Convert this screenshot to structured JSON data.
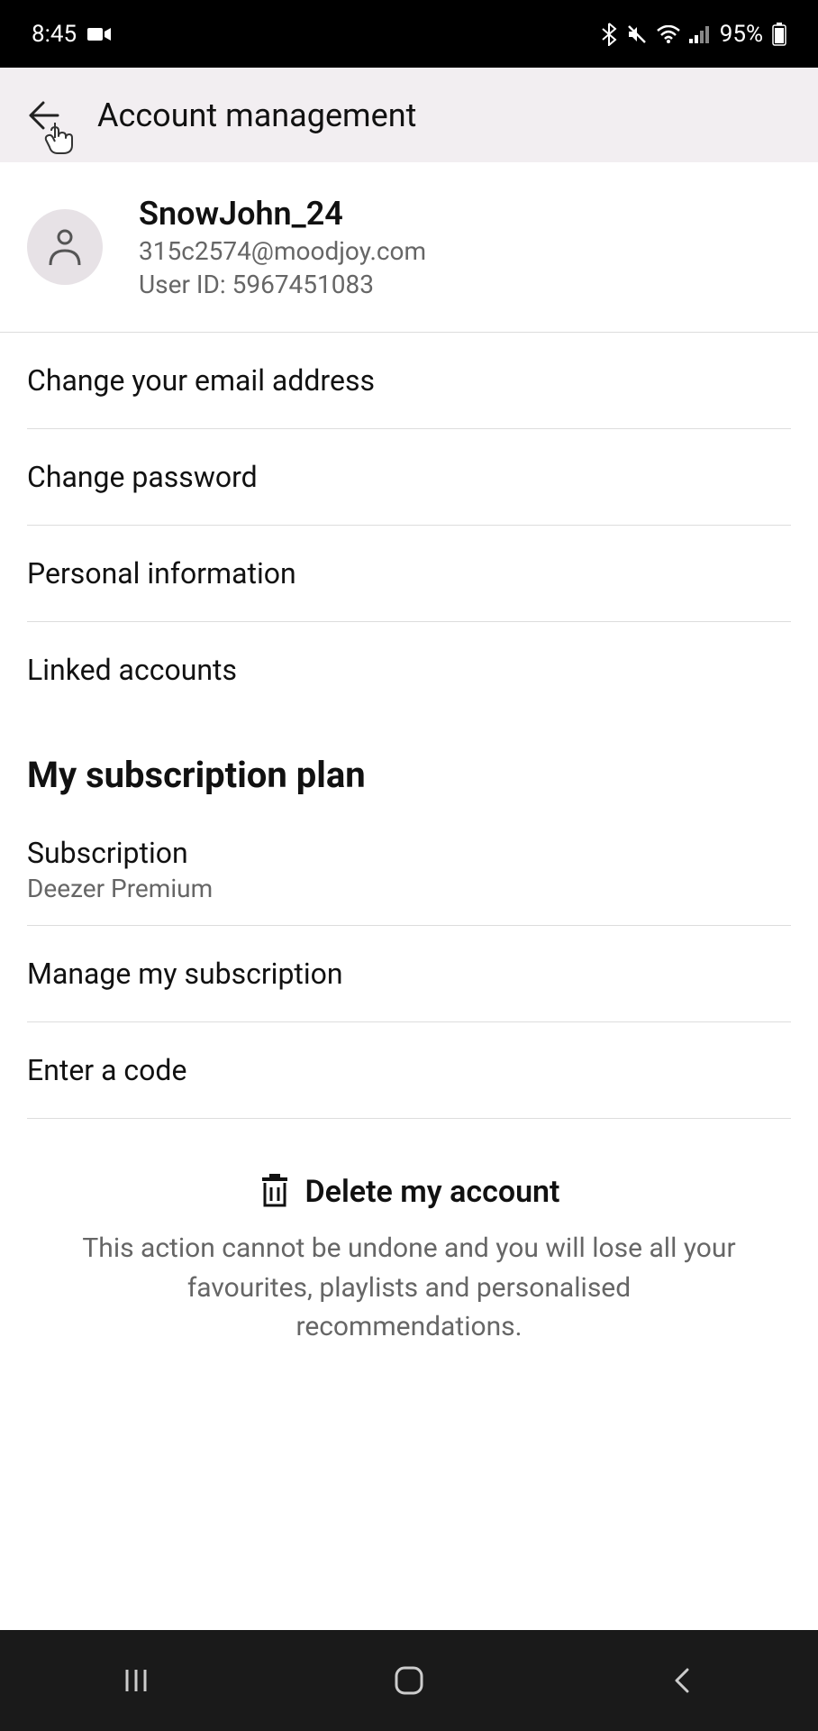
{
  "status": {
    "time": "8:45",
    "battery": "95%"
  },
  "header": {
    "title": "Account management"
  },
  "profile": {
    "username": "SnowJohn_24",
    "email": "315c2574@moodjoy.com",
    "userid_label": "User ID: 5967451083"
  },
  "account_items": [
    {
      "label": "Change your email address"
    },
    {
      "label": "Change password"
    },
    {
      "label": "Personal information"
    },
    {
      "label": "Linked accounts"
    }
  ],
  "subscription": {
    "section_title": "My subscription plan",
    "items": [
      {
        "primary": "Subscription",
        "secondary": "Deezer Premium"
      },
      {
        "primary": "Manage my subscription"
      },
      {
        "primary": "Enter a code"
      }
    ]
  },
  "delete": {
    "label": "Delete my account",
    "warning": "This action cannot be undone and you will lose all your favourites, playlists and personalised recommendations."
  }
}
